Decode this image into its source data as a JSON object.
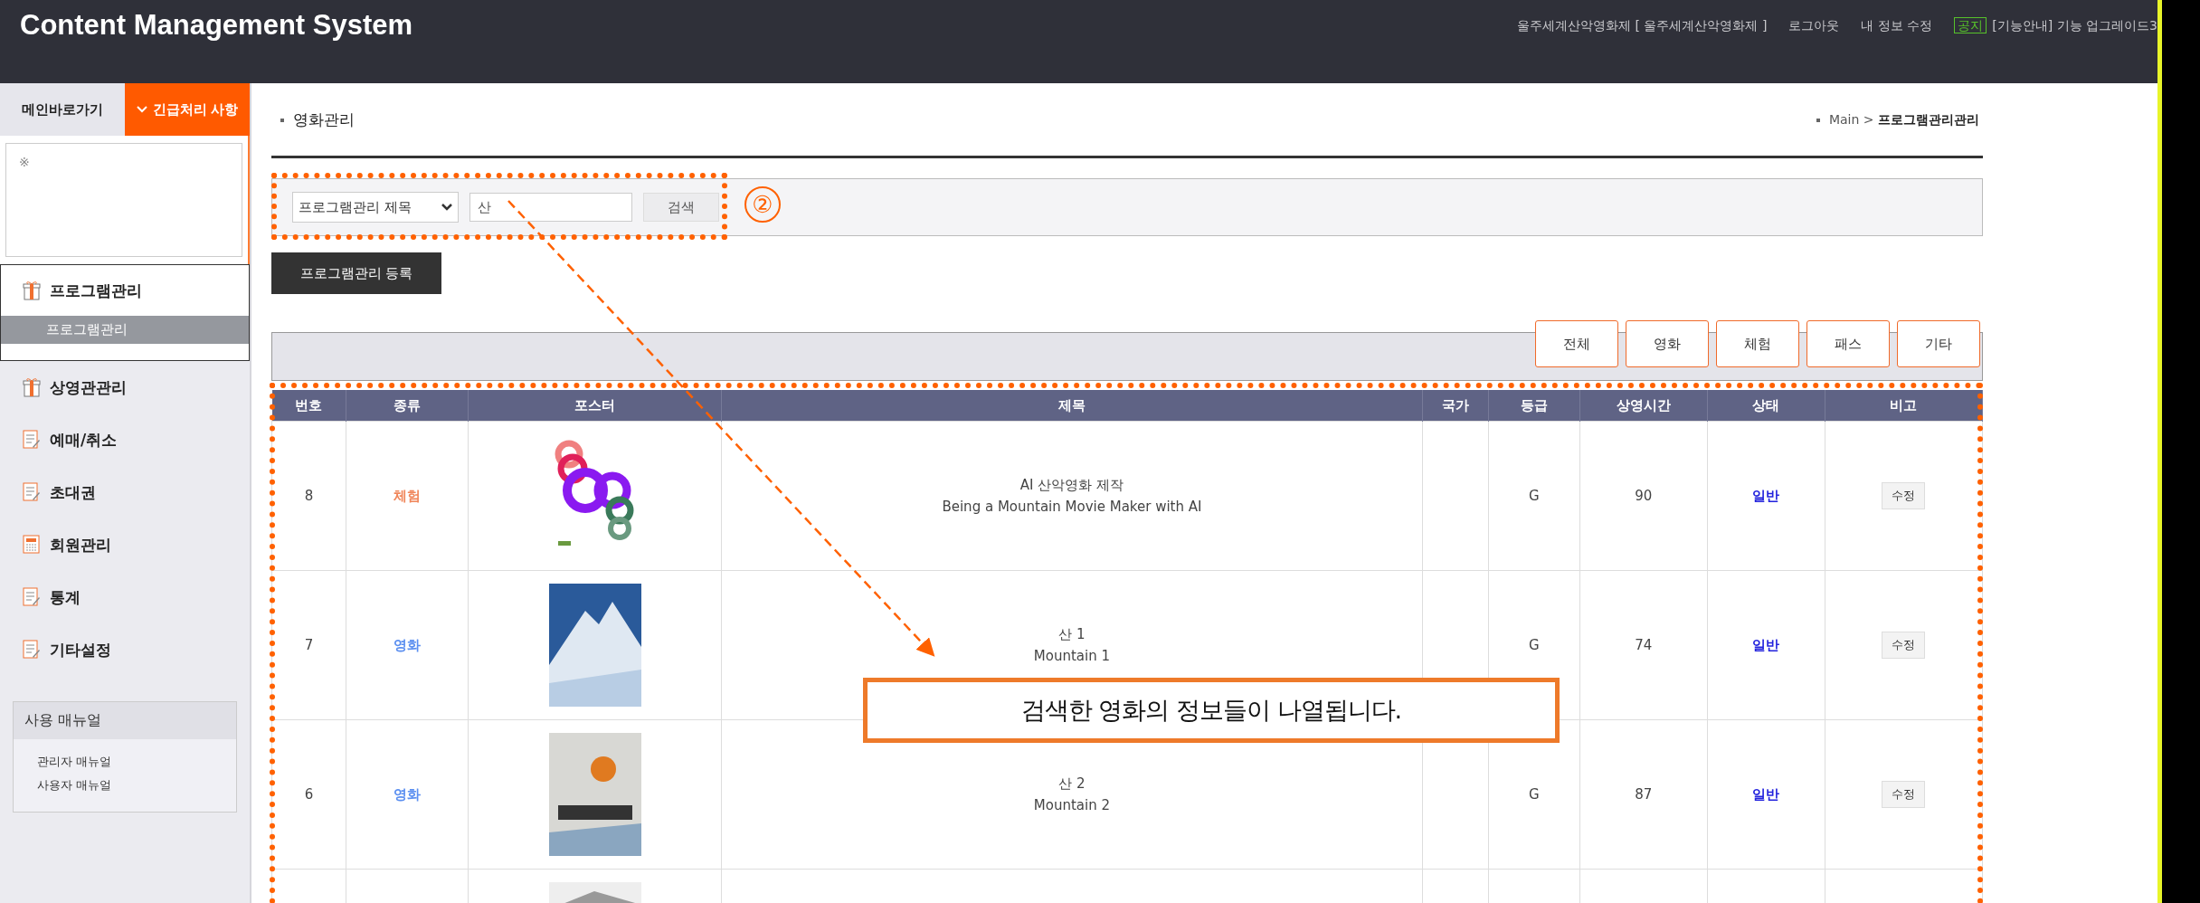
{
  "header": {
    "title": "Content Management System",
    "user": "울주세계산악영화제 [ 울주세계산악영화제 ]",
    "links": [
      "로그아웃",
      "내 정보 수정"
    ],
    "notice": {
      "badge": "공지",
      "text": "[기능안내] 기능 업그레이드3"
    }
  },
  "sidebar": {
    "tabs": [
      {
        "label": "메인바로가기",
        "selected": false
      },
      {
        "label": "긴급처리 사항",
        "selected": true
      }
    ],
    "urgent_note": "※",
    "menu": [
      {
        "label": "프로그램관리",
        "kind": "gift",
        "expanded": true,
        "children": [
          {
            "label": "프로그램관리",
            "selected": true
          }
        ]
      },
      {
        "label": "상영관관리",
        "kind": "gift",
        "expanded": false
      },
      {
        "label": "예매/취소",
        "kind": "note",
        "expanded": false
      },
      {
        "label": "초대권",
        "kind": "note",
        "expanded": false
      },
      {
        "label": "회원관리",
        "kind": "calc",
        "expanded": false
      },
      {
        "label": "통계",
        "kind": "note",
        "expanded": false
      },
      {
        "label": "기타설정",
        "kind": "note",
        "expanded": false
      }
    ],
    "manual": {
      "title": "사용 매뉴얼",
      "links": [
        "관리자 매뉴얼",
        "사용자 매뉴얼"
      ]
    }
  },
  "page": {
    "title": "영화관리",
    "breadcrumb": {
      "root": "Main",
      "separator": ">",
      "current": "프로그램관리관리"
    }
  },
  "search": {
    "field_select": "프로그램관리 제목",
    "query": "산",
    "button": "검색"
  },
  "register_button": "프로그램관리 등록",
  "filters": [
    "전체",
    "영화",
    "체험",
    "패스",
    "기타"
  ],
  "table": {
    "columns": [
      "번호",
      "종류",
      "포스터",
      "제목",
      "국가",
      "등급",
      "상영시간",
      "상태",
      "비고"
    ],
    "rows": [
      {
        "number": "8",
        "type": {
          "label": "체험",
          "color": "#f0865a"
        },
        "kind": "rings",
        "title": "AI 산악영화 제작",
        "title_en": "Being a Mountain Movie Maker with AI",
        "rating": "G",
        "runtime": "90",
        "status": "일반",
        "action": "수정"
      },
      {
        "number": "7",
        "type": {
          "label": "영화",
          "color": "#5b8ff0"
        },
        "kind": "mountain",
        "title": "산 1",
        "title_en": "Mountain 1",
        "rating": "G",
        "runtime": "74",
        "status": "일반",
        "action": "수정"
      },
      {
        "number": "6",
        "type": {
          "label": "영화",
          "color": "#5b8ff0"
        },
        "kind": "climber",
        "title": "산 2",
        "title_en": "Mountain 2",
        "rating": "G",
        "runtime": "87",
        "status": "일반",
        "action": "수정"
      },
      {
        "kind": "snow"
      }
    ]
  },
  "annotation": {
    "step": "②",
    "callout": "검색한 영화의 정보들이 나열됩니다."
  }
}
